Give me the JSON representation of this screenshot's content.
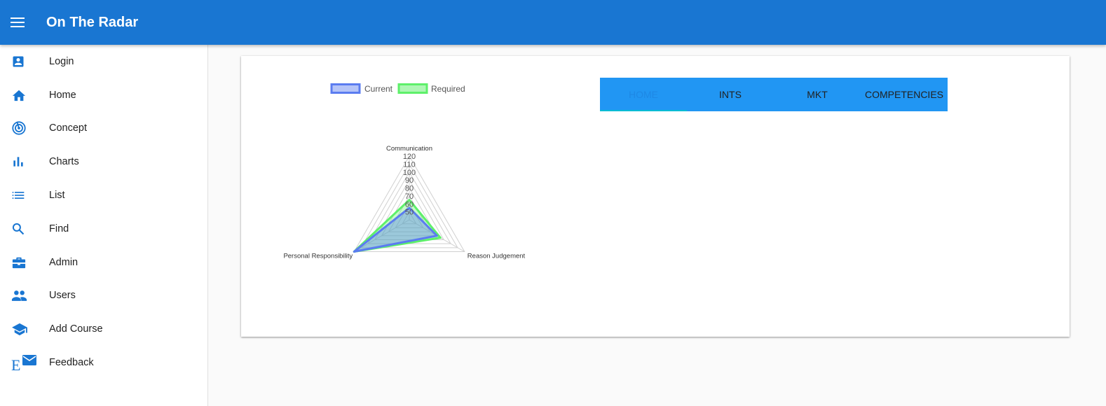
{
  "app": {
    "title": "On The Radar"
  },
  "sidebar": {
    "items": [
      {
        "label": "Login",
        "icon": "account-box-icon"
      },
      {
        "label": "Home",
        "icon": "home-icon"
      },
      {
        "label": "Concept",
        "icon": "radar-icon"
      },
      {
        "label": "Charts",
        "icon": "bar-chart-icon"
      },
      {
        "label": "List",
        "icon": "list-icon"
      },
      {
        "label": "Find",
        "icon": "search-icon"
      },
      {
        "label": "Admin",
        "icon": "briefcase-icon"
      },
      {
        "label": "Users",
        "icon": "people-icon"
      },
      {
        "label": "Add Course",
        "icon": "school-icon"
      },
      {
        "label": "Feedback",
        "icon": "mail-icon"
      }
    ]
  },
  "tabs": [
    {
      "label": "HOME",
      "active": true
    },
    {
      "label": "INTS",
      "active": false
    },
    {
      "label": "MKT",
      "active": false
    },
    {
      "label": "COMPETENCIES",
      "active": false
    }
  ],
  "colors": {
    "primary": "#1976d2",
    "tab_bar": "#2196f3",
    "indicator": "#00bcd4",
    "current_series": "#5b7cf0",
    "required_series": "#5ef06a"
  },
  "chart_data": {
    "type": "radar",
    "categories": [
      "Communication",
      "Reason Judgement",
      "Personal Responsibility"
    ],
    "ticks": [
      "50",
      "60",
      "70",
      "80",
      "90",
      "100",
      "110",
      "120"
    ],
    "rlim": [
      40,
      120
    ],
    "series": [
      {
        "name": "Current",
        "values": [
          55,
          80,
          120
        ]
      },
      {
        "name": "Required",
        "values": [
          65,
          85,
          120
        ]
      }
    ],
    "legend_position": "top"
  }
}
